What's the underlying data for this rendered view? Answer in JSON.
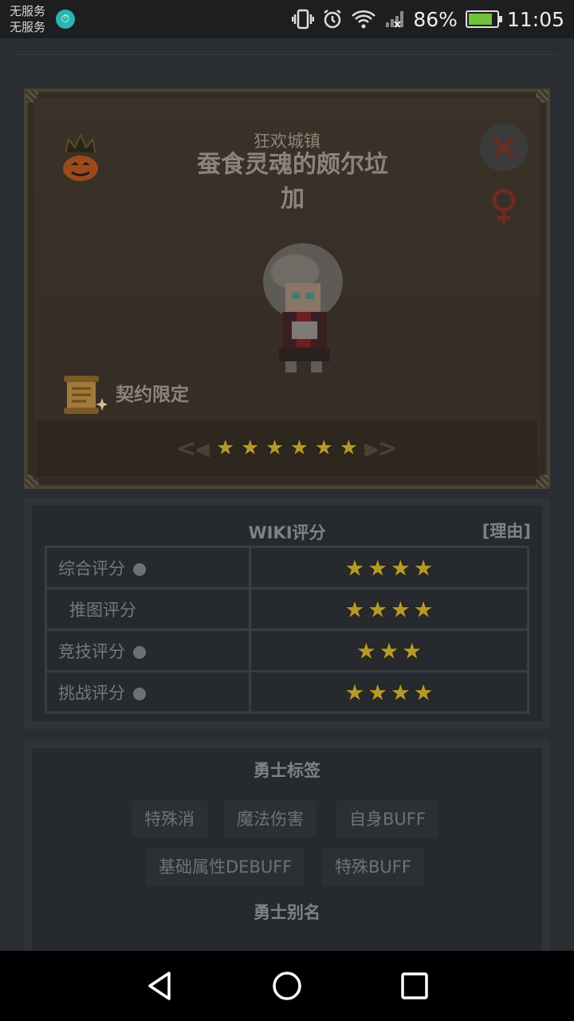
{
  "status_bar": {
    "carrier_1": "无服务",
    "carrier_2": "无服务",
    "battery_percent": "86%",
    "battery_level": 0.86,
    "time": "11:05"
  },
  "hero": {
    "faction": "狂欢城镇",
    "name_line_1": "蚕食灵魂的颇尔垃",
    "name_line_2": "加",
    "contract_label": "契约限定",
    "rarity_stars": 6,
    "faction_icon": "pumpkin-crown-icon",
    "element_icon": "crossed-swords-icon",
    "gender_icon": "female-icon"
  },
  "rating": {
    "title": "WIKI评分",
    "reason_link": "[理由]",
    "rows": [
      {
        "label": "综合评分",
        "has_info": true,
        "stars": 4
      },
      {
        "label": "推图评分",
        "has_info": false,
        "stars": 4
      },
      {
        "label": "竞技评分",
        "has_info": true,
        "stars": 3
      },
      {
        "label": "挑战评分",
        "has_info": true,
        "stars": 4
      }
    ]
  },
  "tags": {
    "heading": "勇士标签",
    "items": [
      "特殊消",
      "魔法伤害",
      "自身BUFF",
      "基础属性DEBUFF",
      "特殊BUFF"
    ],
    "alias_heading": "勇士别名"
  },
  "colors": {
    "star": "#b49a2c",
    "panel": "#262a2e",
    "accent_red": "#6e2a24"
  }
}
